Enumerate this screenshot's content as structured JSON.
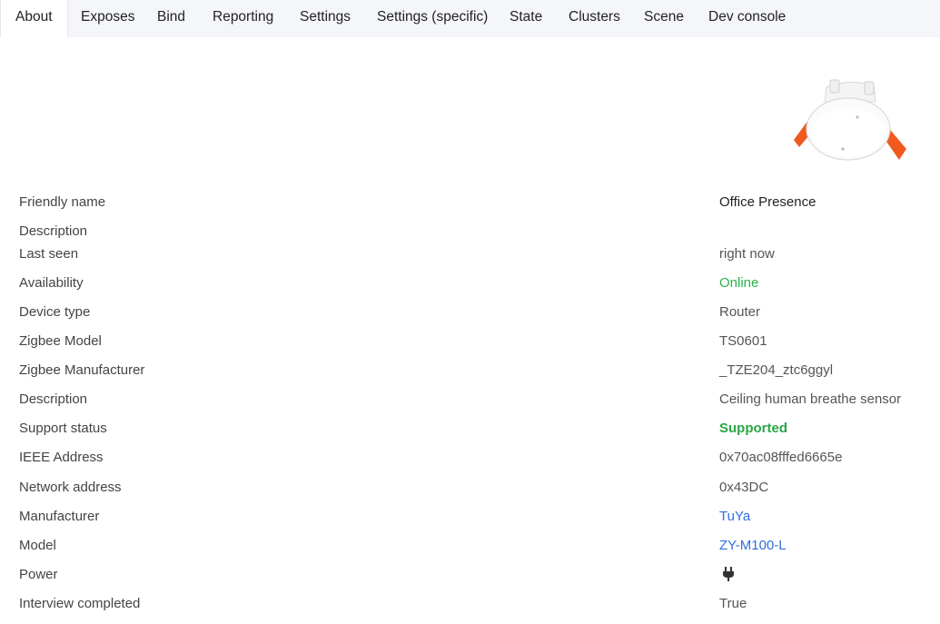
{
  "tabs": [
    {
      "label": "About",
      "active": true
    },
    {
      "label": "Exposes"
    },
    {
      "label": "Bind"
    },
    {
      "label": "Reporting"
    },
    {
      "label": "Settings"
    },
    {
      "label": "Settings (specific)"
    },
    {
      "label": "State"
    },
    {
      "label": "Clusters"
    },
    {
      "label": "Scene"
    },
    {
      "label": "Dev console"
    }
  ],
  "device": {
    "image_icon": "ceiling-presence-sensor-image",
    "rows": [
      {
        "label": "Friendly name",
        "value": "Office Presence"
      },
      {
        "label": "Description",
        "value": ""
      },
      {
        "label": "Last seen",
        "value": "right now"
      },
      {
        "label": "Availability",
        "value": "Online"
      },
      {
        "label": "Device type",
        "value": "Router"
      },
      {
        "label": "Zigbee Model",
        "value": "TS0601"
      },
      {
        "label": "Zigbee Manufacturer",
        "value": "_TZE204_ztc6ggyl"
      },
      {
        "label": "Description",
        "value": "Ceiling human breathe sensor"
      },
      {
        "label": "Support status",
        "value": "Supported"
      },
      {
        "label": "IEEE Address",
        "value": "0x70ac08fffed6665e"
      },
      {
        "label": "Network address",
        "value": "0x43DC"
      },
      {
        "label": "Manufacturer",
        "value": "TuYa"
      },
      {
        "label": "Model",
        "value": "ZY-M100-L"
      },
      {
        "label": "Power",
        "value": "",
        "icon": "plug-icon"
      },
      {
        "label": "Interview completed",
        "value": "True"
      }
    ]
  },
  "colors": {
    "online": "#2bb24c",
    "supported": "#28a745",
    "link": "#2f6fe0",
    "sensor_accent": "#f05a1e"
  }
}
